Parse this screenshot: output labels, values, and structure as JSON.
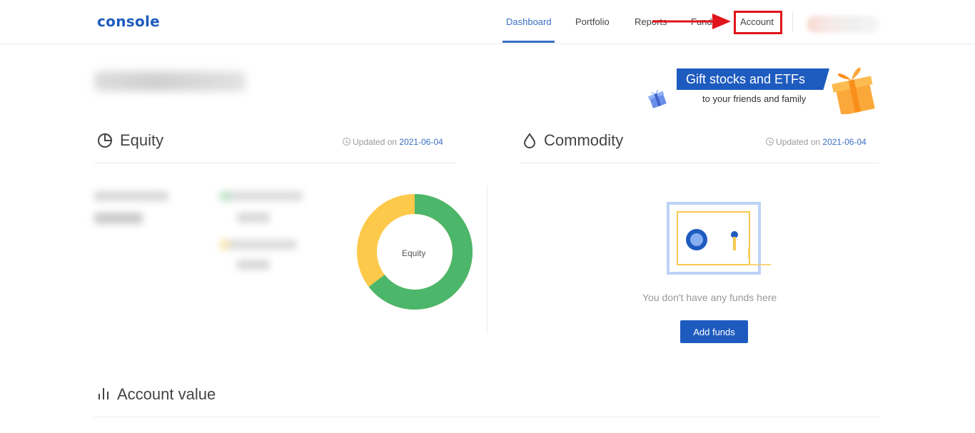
{
  "header": {
    "logo": "console",
    "nav": {
      "dashboard": "Dashboard",
      "portfolio": "Portfolio",
      "reports": "Reports",
      "funds": "Funds",
      "account": "Account"
    }
  },
  "banner": {
    "title": "Gift stocks and ETFs",
    "subtitle": "to your friends and family"
  },
  "equity": {
    "title": "Equity",
    "updated_label": "Updated on",
    "updated_date": "2021-06-04",
    "donut_label": "Equity",
    "colors": {
      "primary": "#4cb66a",
      "secondary": "#fdc94a"
    }
  },
  "commodity": {
    "title": "Commodity",
    "updated_label": "Updated on",
    "updated_date": "2021-06-04",
    "empty_text": "You don't have any funds here",
    "add_button": "Add funds"
  },
  "account_value": {
    "title": "Account value"
  },
  "colors": {
    "brand": "#1e5bbf",
    "highlight": "#e0141b"
  }
}
